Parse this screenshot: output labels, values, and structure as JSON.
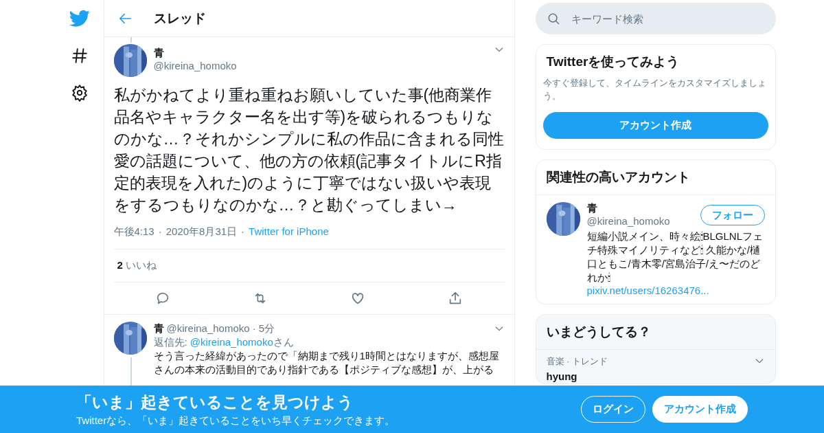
{
  "header": {
    "title": "スレッド"
  },
  "nav": [
    {
      "kind": "hashtag"
    },
    {
      "kind": "settings"
    }
  ],
  "tweet": {
    "name": "青",
    "handle": "@kireina_homoko",
    "text": "私がかねてより重ね重ねお願いしていた事(他商業作品名やキャラクター名を出す等)を破られるつもりなのかな…？それかシンプルに私の作品に含まれる同性愛の話題について、他の方の依頼(記事タイトルにR指定的表現を入れた)のように丁寧ではない扱いや表現をするつもりなのかな…？と勘ぐってしまい→",
    "time": "午後4:13",
    "sep_1": "·",
    "date": "2020年8月31日",
    "sep_2": "·",
    "source": "Twitter for iPhone",
    "likes_count": "2",
    "likes_label": "いいね"
  },
  "reply": {
    "name": "青",
    "handle": "@kireina_homoko",
    "sep": "·",
    "age": "5分",
    "reply_to_label": "返信先:",
    "reply_to": "@kireina_homoko",
    "reply_to_suffix": "さん",
    "text": "そう言った経緯があったので「納期まで残り1時間とはなりますが、感想屋さんの本来の活動目的であり指針である【ポジティブな感想】が、上がる"
  },
  "search": {
    "placeholder": "キーワード検索"
  },
  "signup_card": {
    "title": "Twitterを使ってみよう",
    "text": "今すぐ登録して、タイムラインをカスタマイズしましょう。",
    "button": "アカウント作成"
  },
  "related": {
    "title": "関連性の高いアカウント",
    "name": "青",
    "handle": "@kireina_homoko",
    "follow": "フォロー",
    "bio": "短編小説メイン、時々絵🕯BLGLNLフェチ特殊マイノリティなど🕯 久能かな/樋口ともこ/青木零/宮島治子/え〜だのどれか🕯",
    "link": "pixiv.net/users/16263476..."
  },
  "trends": {
    "title": "いまどうしてる？",
    "items": [
      {
        "context": "音楽 · トレンド",
        "name": "hyung"
      }
    ]
  },
  "banner": {
    "title": "「いま」起きていることを見つけよう",
    "text": "Twitterなら、「いま」起きていることをいち早くチェックできます。",
    "login": "ログイン",
    "signup": "アカウント作成"
  }
}
